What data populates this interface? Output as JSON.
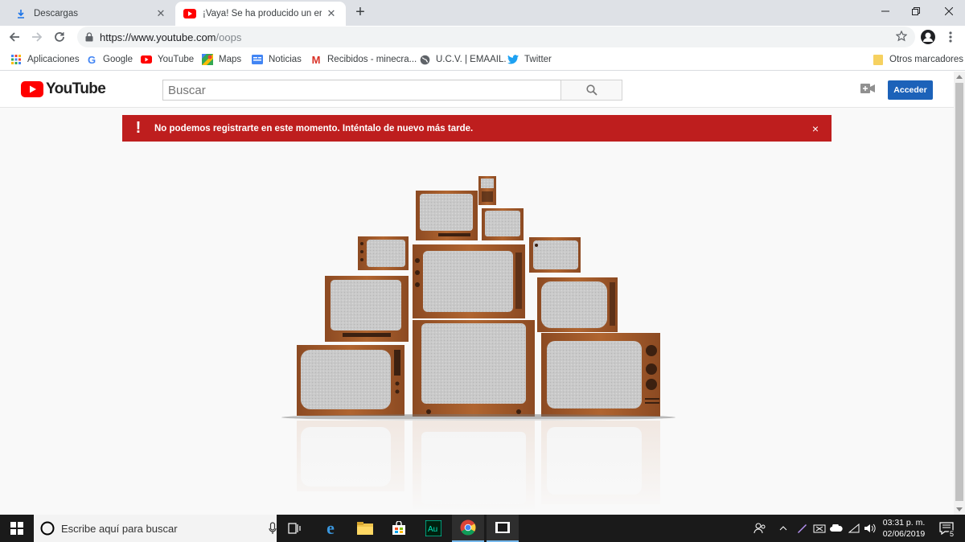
{
  "browser": {
    "tabs": [
      {
        "title": "Descargas",
        "active": false
      },
      {
        "title": "¡Vaya! Se ha producido un error",
        "active": true
      }
    ],
    "address": {
      "host": "https://www.youtube.com",
      "path": "/oops"
    },
    "bookmarks": [
      {
        "label": "Aplicaciones",
        "icon": "apps-grid-icon"
      },
      {
        "label": "Google",
        "icon": "google-icon"
      },
      {
        "label": "YouTube",
        "icon": "youtube-icon"
      },
      {
        "label": "Maps",
        "icon": "maps-icon"
      },
      {
        "label": "Noticias",
        "icon": "news-icon"
      },
      {
        "label": "Recibidos - minecra...",
        "icon": "gmail-icon"
      },
      {
        "label": "U.C.V. | EMAAIL.",
        "icon": "globe-icon"
      },
      {
        "label": "Twitter",
        "icon": "twitter-icon"
      }
    ],
    "other_bookmarks": "Otros marcadores"
  },
  "youtube": {
    "logo_text": "YouTube",
    "search_placeholder": "Buscar",
    "signin_label": "Acceder",
    "alert_message": "No podemos registrarte en este momento. Inténtalo de nuevo más tarde.",
    "alert_icon": "!",
    "alert_close": "×"
  },
  "taskbar": {
    "search_placeholder": "Escribe aquí para buscar",
    "time": "03:31 p. m.",
    "date": "02/06/2019",
    "notification_count": "5"
  },
  "colors": {
    "brand_red": "#ff0000",
    "alert_red": "#be1e1e",
    "signin_blue": "#1c62b9",
    "tv_wood": "#a0552a"
  }
}
